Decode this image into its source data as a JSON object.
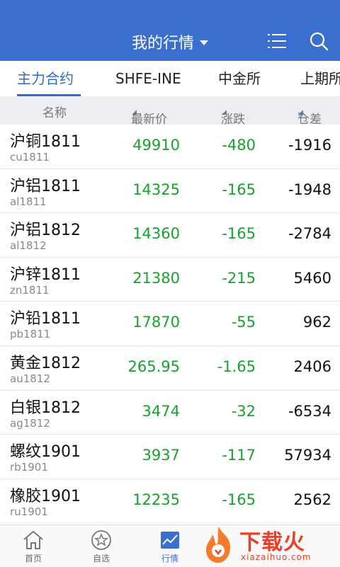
{
  "header": {
    "title": "我的行情",
    "bg_color": "#3a6fd0"
  },
  "tabs": [
    {
      "label": "主力合约",
      "active": true
    },
    {
      "label": "SHFE-INE",
      "active": false
    },
    {
      "label": "中金所",
      "active": false
    },
    {
      "label": "上期所",
      "active": false
    }
  ],
  "columns": {
    "name": "名称",
    "price": "最新价",
    "change": "涨跌",
    "position": "仓差"
  },
  "rows": [
    {
      "name": "沪铜1811",
      "code": "cu1811",
      "price": "49910",
      "change": "-480",
      "position": "-1916"
    },
    {
      "name": "沪铝1811",
      "code": "al1811",
      "price": "14325",
      "change": "-165",
      "position": "-1948"
    },
    {
      "name": "沪铝1812",
      "code": "al1812",
      "price": "14360",
      "change": "-165",
      "position": "-2784"
    },
    {
      "name": "沪锌1811",
      "code": "zn1811",
      "price": "21380",
      "change": "-215",
      "position": "5460"
    },
    {
      "name": "沪铅1811",
      "code": "pb1811",
      "price": "17870",
      "change": "-55",
      "position": "962"
    },
    {
      "name": "黄金1812",
      "code": "au1812",
      "price": "265.95",
      "change": "-1.65",
      "position": "2406"
    },
    {
      "name": "白银1812",
      "code": "ag1812",
      "price": "3474",
      "change": "-32",
      "position": "-6534"
    },
    {
      "name": "螺纹1901",
      "code": "rb1901",
      "price": "3937",
      "change": "-117",
      "position": "57934"
    },
    {
      "name": "橡胶1901",
      "code": "ru1901",
      "price": "12235",
      "change": "-165",
      "position": "2562"
    }
  ],
  "bottom_nav": [
    {
      "label": "首页",
      "icon": "home-icon",
      "active": false
    },
    {
      "label": "自选",
      "icon": "star-icon",
      "active": false
    },
    {
      "label": "行情",
      "icon": "chart-icon",
      "active": true
    }
  ],
  "watermark": {
    "text": "下载火",
    "domain": "xiazaihuo.com"
  },
  "colors": {
    "down": "#17a12d",
    "accent": "#2f6ec8"
  }
}
